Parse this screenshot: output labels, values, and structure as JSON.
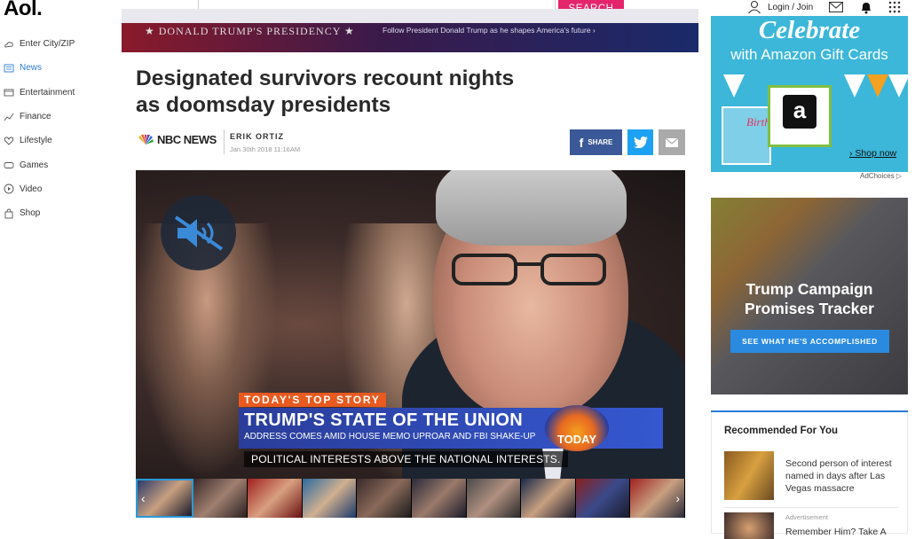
{
  "brand": {
    "logo": "Aol."
  },
  "sidebar": {
    "items": [
      {
        "label": "Enter City/ZIP",
        "icon": "weather-icon",
        "active": false
      },
      {
        "label": "News",
        "icon": "news-icon",
        "active": true
      },
      {
        "label": "Entertainment",
        "icon": "entertainment-icon",
        "active": false
      },
      {
        "label": "Finance",
        "icon": "finance-icon",
        "active": false
      },
      {
        "label": "Lifestyle",
        "icon": "heart-icon",
        "active": false
      },
      {
        "label": "Games",
        "icon": "gamepad-icon",
        "active": false
      },
      {
        "label": "Video",
        "icon": "play-icon",
        "active": false
      },
      {
        "label": "Shop",
        "icon": "shopping-bag-icon",
        "active": false
      }
    ]
  },
  "search": {
    "placeholder": "",
    "button_label": "SEARCH"
  },
  "header": {
    "login_label": "Login / Join"
  },
  "banner": {
    "title": "★ DONALD TRUMP'S PRESIDENCY ★",
    "subtitle": "Follow President Donald Trump as he shapes America's future ›"
  },
  "article": {
    "headline": "Designated survivors recount nights as doomsday presidents",
    "source": "NBC NEWS",
    "author": "ERIK ORTIZ",
    "date": "Jan 30th 2018 11:16AM",
    "share_label": "SHARE"
  },
  "video": {
    "tag": "TODAY'S TOP STORY",
    "lower_title": "TRUMP'S STATE OF THE UNION",
    "lower_sub": "ADDRESS COMES AMID HOUSE MEMO UPROAR AND FBI SHAKE-UP",
    "show_logo": "TODAY",
    "caption": "POLITICAL INTERESTS ABOVE THE NATIONAL INTERESTS.",
    "muted": true,
    "thumb_count": 10,
    "selected_thumb": 0
  },
  "ads": {
    "amazon": {
      "headline": "Celebrate",
      "subline": "with Amazon Gift Cards",
      "card_letter": "a",
      "card_text": "Birth",
      "cta": "› Shop now",
      "adchoices": "AdChoices ▷"
    },
    "tracker": {
      "headline": "Trump Campaign Promises Tracker",
      "cta": "SEE WHAT HE'S ACCOMPLISHED"
    }
  },
  "recommended": {
    "title": "Recommended For You",
    "items": [
      {
        "text": "Second person of interest named in days after Las Vegas massacre"
      },
      {
        "label": "Advertisement",
        "text": "Remember Him? Take A"
      }
    ]
  },
  "colors": {
    "accent": "#2a7ad8",
    "search_button": "#e5256b",
    "facebook": "#3b5998",
    "twitter": "#1da1f2"
  }
}
